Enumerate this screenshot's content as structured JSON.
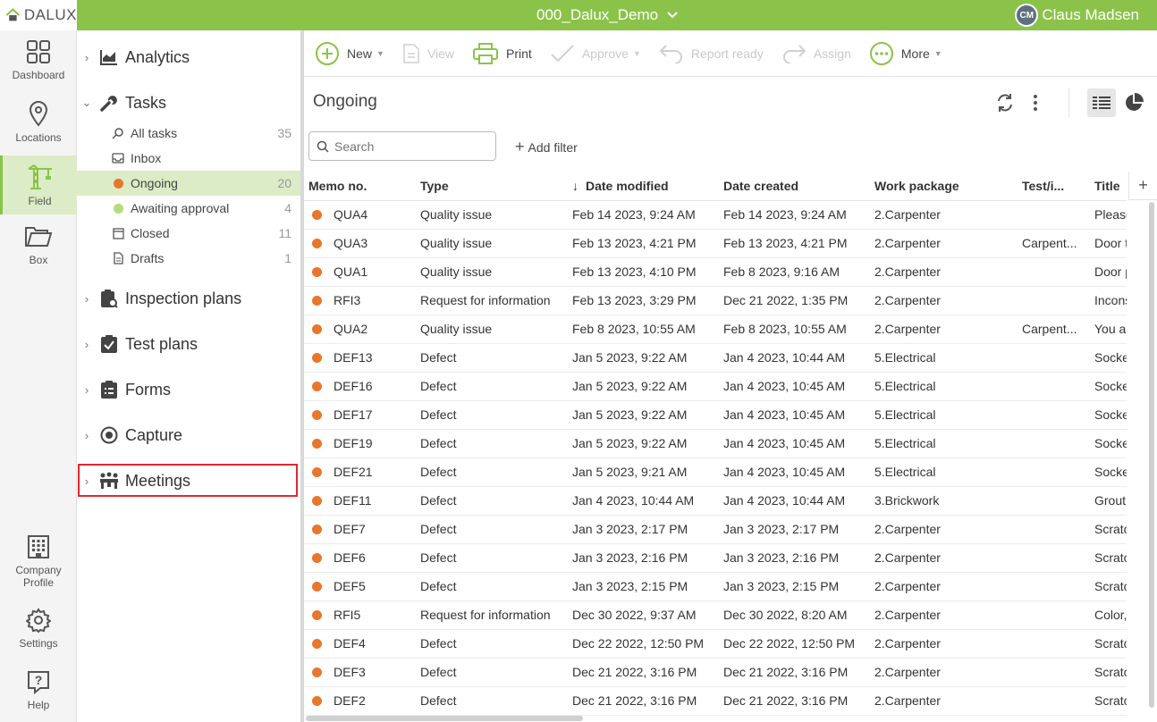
{
  "app": {
    "logo_text": "DALUX",
    "project_name": "000_Dalux_Demo",
    "user_initials": "CM",
    "user_name": "Claus Madsen",
    "brand_color": "#8bc34a"
  },
  "rail": {
    "items": [
      {
        "label": "Dashboard",
        "icon": "dashboard-icon"
      },
      {
        "label": "Locations",
        "icon": "location-pin-icon"
      },
      {
        "label": "Field",
        "icon": "crane-icon",
        "active": true
      },
      {
        "label": "Box",
        "icon": "folder-icon"
      },
      {
        "label": "Company Profile",
        "icon": "building-icon"
      },
      {
        "label": "Settings",
        "icon": "gear-icon"
      },
      {
        "label": "Help",
        "icon": "help-icon"
      }
    ]
  },
  "sidebar": {
    "sections": [
      {
        "label": "Analytics",
        "icon": "analytics-icon"
      },
      {
        "label": "Tasks",
        "icon": "wrench-icon",
        "expanded": true
      },
      {
        "label": "Inspection plans",
        "icon": "inspection-plan-icon"
      },
      {
        "label": "Test plans",
        "icon": "test-plan-icon"
      },
      {
        "label": "Forms",
        "icon": "forms-icon"
      },
      {
        "label": "Capture",
        "icon": "capture-icon"
      },
      {
        "label": "Meetings",
        "icon": "meetings-icon"
      }
    ],
    "task_items": [
      {
        "label": "All tasks",
        "count": "35",
        "icon": "search-icon"
      },
      {
        "label": "Inbox",
        "count": "",
        "icon": "inbox-icon"
      },
      {
        "label": "Ongoing",
        "count": "20",
        "icon": "orange-dot",
        "active": true
      },
      {
        "label": "Awaiting approval",
        "count": "4",
        "icon": "green-dot"
      },
      {
        "label": "Closed",
        "count": "11",
        "icon": "closed-icon"
      },
      {
        "label": "Drafts",
        "count": "1",
        "icon": "drafts-icon"
      }
    ],
    "status_colors": {
      "ongoing": "#e8762d",
      "awaiting": "#b5dc7a"
    }
  },
  "toolbar": {
    "new_label": "New",
    "view_label": "View",
    "print_label": "Print",
    "approve_label": "Approve",
    "report_ready_label": "Report ready",
    "assign_label": "Assign",
    "more_label": "More"
  },
  "view": {
    "title": "Ongoing",
    "search_placeholder": "Search",
    "add_filter_label": "Add filter"
  },
  "table": {
    "columns": [
      "Memo no.",
      "Type",
      "Date modified",
      "Date created",
      "Work package",
      "Test/i...",
      "Title"
    ],
    "sort_column": "Date modified",
    "rows": [
      [
        "QUA4",
        "Quality issue",
        "Feb 14 2023, 9:24 AM",
        "Feb 14 2023, 9:24 AM",
        "2.Carpenter",
        "",
        "Please se"
      ],
      [
        "QUA3",
        "Quality issue",
        "Feb 13 2023, 4:21 PM",
        "Feb 13 2023, 4:21 PM",
        "2.Carpenter",
        "Carpent...",
        "Door type"
      ],
      [
        "QUA1",
        "Quality issue",
        "Feb 13 2023, 4:10 PM",
        "Feb 8 2023, 9:16 AM",
        "2.Carpenter",
        "",
        "Door pan"
      ],
      [
        "RFI3",
        "Request for information",
        "Feb 13 2023, 3:29 PM",
        "Dec 21 2022, 1:35 PM",
        "2.Carpenter",
        "",
        "Inconsist"
      ],
      [
        "QUA2",
        "Quality issue",
        "Feb 8 2023, 10:55 AM",
        "Feb 8 2023, 10:55 AM",
        "2.Carpenter",
        "Carpent...",
        "You are b"
      ],
      [
        "DEF13",
        "Defect",
        "Jan 5 2023, 9:22 AM",
        "Jan 4 2023, 10:44 AM",
        "5.Electrical",
        "",
        "Socket lo"
      ],
      [
        "DEF16",
        "Defect",
        "Jan 5 2023, 9:22 AM",
        "Jan 4 2023, 10:45 AM",
        "5.Electrical",
        "",
        "Socket lo"
      ],
      [
        "DEF17",
        "Defect",
        "Jan 5 2023, 9:22 AM",
        "Jan 4 2023, 10:45 AM",
        "5.Electrical",
        "",
        "Socket lo"
      ],
      [
        "DEF19",
        "Defect",
        "Jan 5 2023, 9:22 AM",
        "Jan 4 2023, 10:45 AM",
        "5.Electrical",
        "",
        "Socket lo"
      ],
      [
        "DEF21",
        "Defect",
        "Jan 5 2023, 9:21 AM",
        "Jan 4 2023, 10:45 AM",
        "5.Electrical",
        "",
        "Socket lo"
      ],
      [
        "DEF11",
        "Defect",
        "Jan 4 2023, 10:44 AM",
        "Jan 4 2023, 10:44 AM",
        "3.Brickwork",
        "",
        "Grout dar"
      ],
      [
        "DEF7",
        "Defect",
        "Jan 3 2023, 2:17 PM",
        "Jan 3 2023, 2:17 PM",
        "2.Carpenter",
        "",
        "Scratch"
      ],
      [
        "DEF6",
        "Defect",
        "Jan 3 2023, 2:16 PM",
        "Jan 3 2023, 2:16 PM",
        "2.Carpenter",
        "",
        "Scratch"
      ],
      [
        "DEF5",
        "Defect",
        "Jan 3 2023, 2:15 PM",
        "Jan 3 2023, 2:15 PM",
        "2.Carpenter",
        "",
        "Scratch"
      ],
      [
        "RFI5",
        "Request for information",
        "Dec 30 2022, 9:37 AM",
        "Dec 30 2022, 8:20 AM",
        "2.Carpenter",
        "",
        "Color, int"
      ],
      [
        "DEF4",
        "Defect",
        "Dec 22 2022, 12:50 PM",
        "Dec 22 2022, 12:50 PM",
        "2.Carpenter",
        "",
        "Scratch"
      ],
      [
        "DEF3",
        "Defect",
        "Dec 21 2022, 3:16 PM",
        "Dec 21 2022, 3:16 PM",
        "2.Carpenter",
        "",
        "Scratch"
      ],
      [
        "DEF2",
        "Defect",
        "Dec 21 2022, 3:16 PM",
        "Dec 21 2022, 3:16 PM",
        "2.Carpenter",
        "",
        "Scratch"
      ]
    ]
  }
}
